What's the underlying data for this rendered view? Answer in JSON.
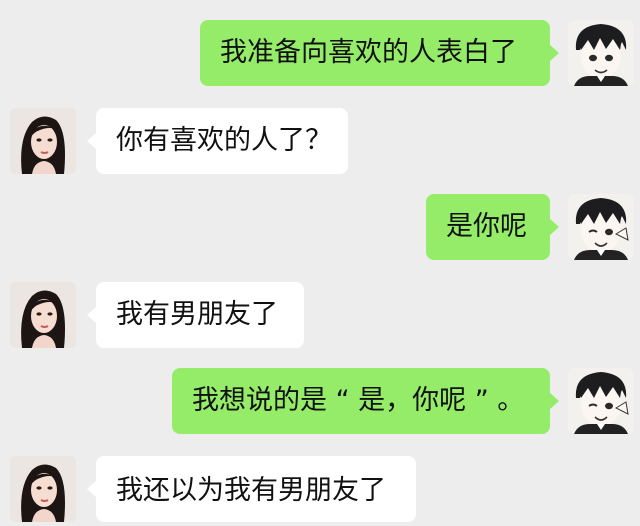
{
  "messages": [
    {
      "side": "right",
      "sender": "boy",
      "text": "我准备向喜欢的人表白了"
    },
    {
      "side": "left",
      "sender": "girl",
      "text": "你有喜欢的人了？"
    },
    {
      "side": "right",
      "sender": "boy",
      "text": "是你呢"
    },
    {
      "side": "left",
      "sender": "girl",
      "text": "我有男朋友了"
    },
    {
      "side": "right",
      "sender": "boy",
      "text": "我想说的是 “ 是，你呢 ” 。"
    },
    {
      "side": "left",
      "sender": "girl",
      "text": "我还以为我有男朋友了"
    }
  ],
  "colors": {
    "background": "#ededed",
    "bubble_out": "#95ec69",
    "bubble_in": "#ffffff"
  },
  "icons": {
    "boy_avatar": "anime-boy-avatar-icon",
    "girl_avatar": "girl-photo-avatar-icon"
  }
}
